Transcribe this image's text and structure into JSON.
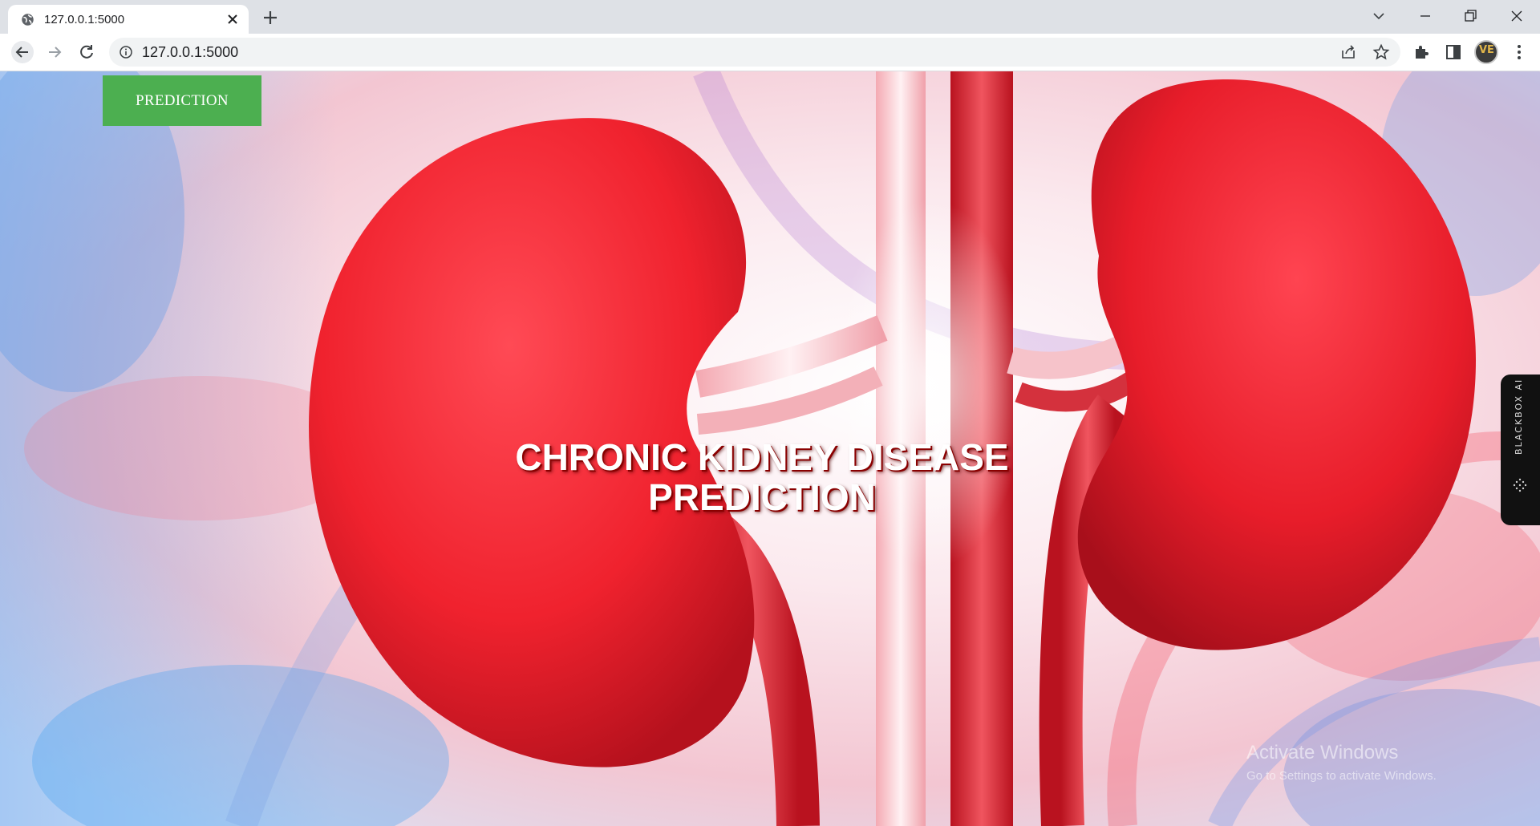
{
  "browser": {
    "tab_title": "127.0.0.1:5000",
    "url": "127.0.0.1:5000",
    "avatar_initials": "VE"
  },
  "page": {
    "nav_button_label": "PREDICTION",
    "hero_title_line1": "CHRONIC KIDNEY DISEASE",
    "hero_title_line2": "PREDICTION",
    "side_widget_label": "BLACKBOX AI",
    "watermark_title": "Activate Windows",
    "watermark_subtitle": "Go to Settings to activate Windows."
  },
  "colors": {
    "button_green": "#4caf50",
    "kidney_red": "#e8202a",
    "toolbar_bg": "#ffffff",
    "tabstrip_bg": "#dee1e6"
  },
  "icons": [
    "globe-icon",
    "close-icon",
    "plus-icon",
    "chevron-down-icon",
    "minimize-icon",
    "restore-icon",
    "window-close-icon",
    "back-arrow-icon",
    "forward-arrow-icon",
    "reload-icon",
    "info-icon",
    "share-icon",
    "star-icon",
    "puzzle-icon",
    "sidepanel-icon",
    "kebab-menu-icon"
  ]
}
